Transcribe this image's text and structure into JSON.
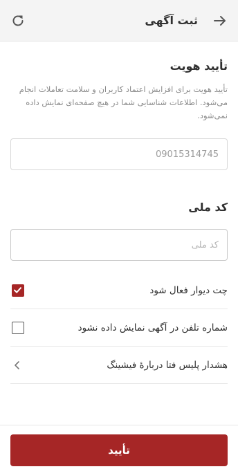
{
  "header": {
    "title": "ثبت آگهی",
    "back_icon": "arrow-right-icon",
    "refresh_icon": "refresh-icon"
  },
  "identity": {
    "title": "تأیید هویت",
    "description": "تأیید هویت برای افزایش اعتماد کاربران و سلامت تعاملات انجام می‌شود. اطلاعات شناسایی شما در هیچ صفحه‌ای نمایش داده نمی‌شود.",
    "phone_value": "09015314745"
  },
  "national_code": {
    "title": "کد ملی",
    "placeholder": "کد ملی"
  },
  "options": {
    "chat_label": "چت دیوار فعال شود",
    "chat_checked": true,
    "hide_phone_label": "شماره تلفن در آگهی نمایش داده نشود",
    "hide_phone_checked": false,
    "warning_label": "هشدار پلیس فتا دربارهٔ فیشینگ"
  },
  "footer": {
    "submit_label": "تأیید"
  },
  "colors": {
    "accent": "#a62626",
    "header_bg": "#f4f4f4"
  }
}
